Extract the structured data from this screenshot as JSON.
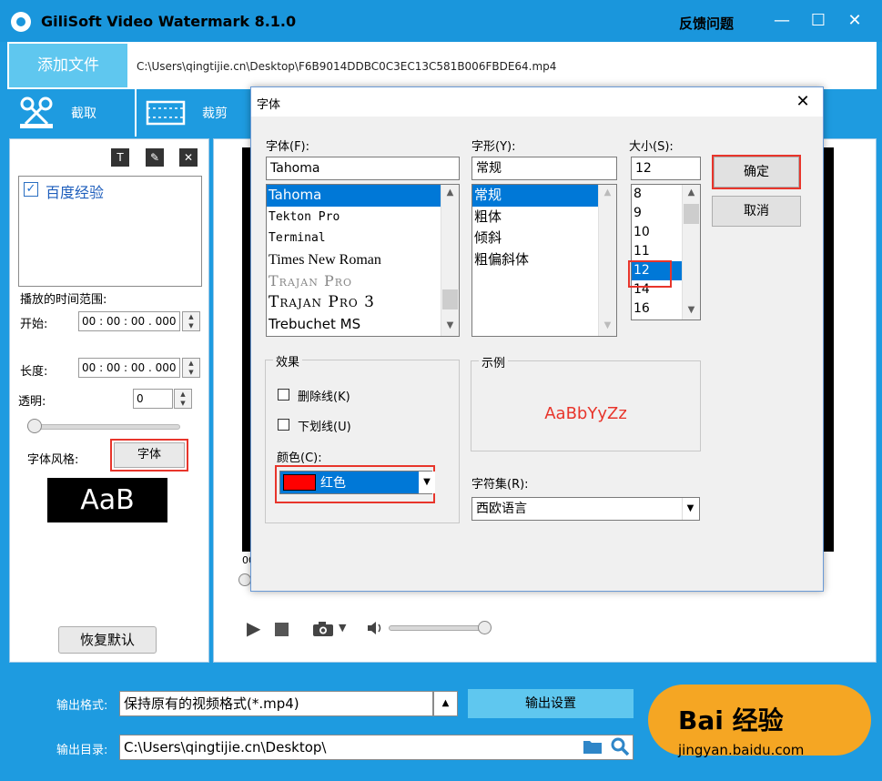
{
  "window": {
    "title": "GiliSoft Video Watermark 8.1.0",
    "feedback": "反馈问题",
    "min": "—",
    "max": "☐",
    "close": "✕"
  },
  "file": {
    "add_label": "添加文件",
    "path": "C:\\Users\\qingtijie.cn\\Desktop\\F6B9014DDBC0C3EC13C581B006FBDE64.mp4"
  },
  "toolbar": {
    "cut_label": "截取",
    "crop_label": "裁剪"
  },
  "left_panel": {
    "watermark_item": "百度经验",
    "checked": "✓",
    "time_range_label": "播放的时间范围:",
    "start_label": "开始:",
    "start_value": "00 : 00 : 00 . 000",
    "length_label": "长度:",
    "length_value": "00 : 00 : 00 . 000",
    "opacity_label": "透明:",
    "opacity_value": "0",
    "opacity_level": 0,
    "font_style_label": "字体风格:",
    "font_button": "字体",
    "preview_text": "AaB",
    "restore_default": "恢复默认"
  },
  "preview": {
    "time_prefix": "00"
  },
  "bottom": {
    "format_label": "输出格式:",
    "format_value": "保持原有的视频格式(*.mp4)",
    "output_settings": "输出设置",
    "dir_label": "输出目录:",
    "dir_value": "C:\\Users\\qingtijie.cn\\Desktop\\",
    "baidu_logo": "Bai 经验",
    "baidu_url": "jingyan.baidu.com"
  },
  "dialog": {
    "title": "字体",
    "font_label": "字体(F):",
    "font_value": "Tahoma",
    "fonts": [
      "Tahoma",
      "Tekton Pro",
      "Terminal",
      "Times New Roman",
      "Trajan Pro",
      "Trajan Pro 3",
      "Trebuchet MS"
    ],
    "style_label": "字形(Y):",
    "style_value": "常规",
    "styles": [
      "常规",
      "粗体",
      "倾斜",
      "粗偏斜体"
    ],
    "size_label": "大小(S):",
    "size_value": "12",
    "sizes": [
      "8",
      "9",
      "10",
      "11",
      "12",
      "14",
      "16"
    ],
    "ok": "确定",
    "cancel": "取消",
    "effects_label": "效果",
    "strikeout": "删除线(K)",
    "underline": "下划线(U)",
    "color_label": "颜色(C):",
    "color_value": "红色",
    "color_swatch": "#ff0000",
    "sample_label": "示例",
    "sample_text": "AaBbYyZz",
    "charset_label": "字符集(R):",
    "charset_value": "西欧语言"
  }
}
